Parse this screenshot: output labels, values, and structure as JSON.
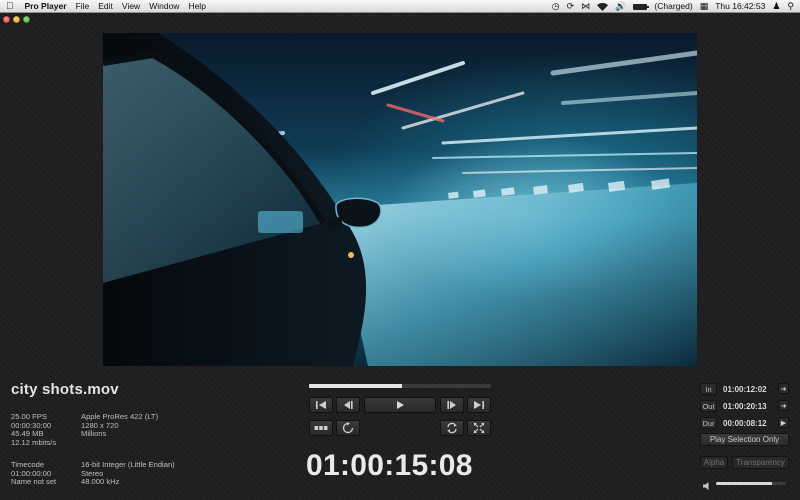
{
  "menubar": {
    "app_name": "Pro Player",
    "menus": [
      "File",
      "Edit",
      "View",
      "Window",
      "Help"
    ],
    "status": {
      "battery_text": "(Charged)",
      "clock": "Thu 16:42:53"
    }
  },
  "video": {
    "file_title": "city shots.mov"
  },
  "metadata": {
    "left_col": [
      "25.00 FPS",
      "00:00:30:00",
      "45.49 MB",
      "12.12 mbits/s"
    ],
    "mid_col": [
      "Apple ProRes 422 (LT)",
      "1280 x 720",
      "Millions"
    ],
    "left_col2": [
      "Timecode",
      "01:00:00:00",
      "Name not set"
    ],
    "mid_col2": [
      "16-bit Integer (Little Endian)",
      "Stereo",
      "48.000 kHz"
    ]
  },
  "transport": {
    "progress": 0.51,
    "timecode": "01:00:15:08"
  },
  "selection": {
    "in_label": "In",
    "in_value": "01:00:12:02",
    "out_label": "Out",
    "out_value": "01:00:20:13",
    "dur_label": "Dur",
    "dur_value": "00:00:08:12",
    "play_selection_label": "Play Selection Only"
  },
  "view_options": {
    "alpha_label": "Alpha",
    "transparency_label": "Transparency"
  },
  "audio": {
    "volume": 0.8
  },
  "colors": {
    "panel_bg": "#1e1e20",
    "text": "#cfcfcf",
    "accent": "#e6e6e6"
  }
}
